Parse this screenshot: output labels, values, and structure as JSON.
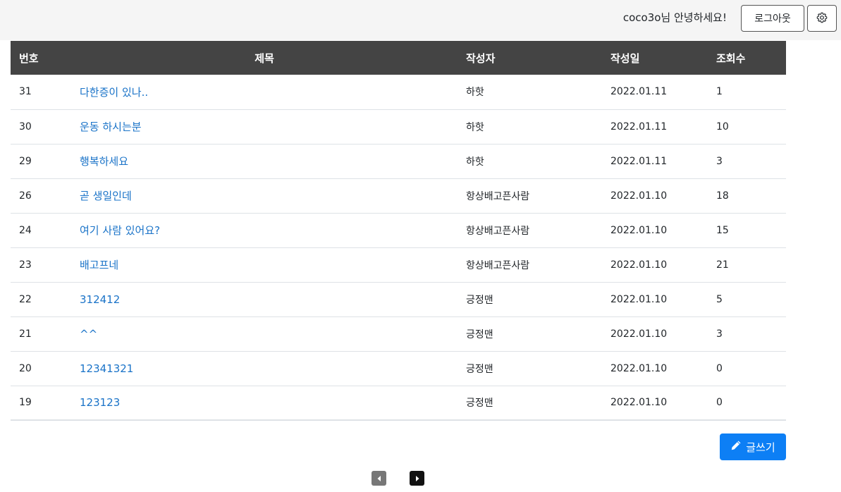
{
  "header": {
    "greeting": "coco3o님 안녕하세요!",
    "logout_label": "로그아웃",
    "settings_icon": "gear-icon"
  },
  "table": {
    "columns": [
      "번호",
      "제목",
      "작성자",
      "작성일",
      "조회수"
    ],
    "rows": [
      {
        "num": "31",
        "title": "다한증이 있나..",
        "author": "하핫",
        "date": "2022.01.11",
        "views": "1"
      },
      {
        "num": "30",
        "title": "운동 하시는분",
        "author": "하핫",
        "date": "2022.01.11",
        "views": "10"
      },
      {
        "num": "29",
        "title": "행복하세요",
        "author": "하핫",
        "date": "2022.01.11",
        "views": "3"
      },
      {
        "num": "26",
        "title": "곧 생일인데",
        "author": "항상배고픈사람",
        "date": "2022.01.10",
        "views": "18"
      },
      {
        "num": "24",
        "title": "여기 사람 있어요?",
        "author": "항상배고픈사람",
        "date": "2022.01.10",
        "views": "15"
      },
      {
        "num": "23",
        "title": "배고프네",
        "author": "항상배고픈사람",
        "date": "2022.01.10",
        "views": "21"
      },
      {
        "num": "22",
        "title": "312412",
        "author": "긍정맨",
        "date": "2022.01.10",
        "views": "5"
      },
      {
        "num": "21",
        "title": "^^",
        "author": "긍정맨",
        "date": "2022.01.10",
        "views": "3"
      },
      {
        "num": "20",
        "title": "12341321",
        "author": "긍정맨",
        "date": "2022.01.10",
        "views": "0"
      },
      {
        "num": "19",
        "title": "123123",
        "author": "긍정맨",
        "date": "2022.01.10",
        "views": "0"
      }
    ]
  },
  "actions": {
    "write_label": "글쓰기",
    "write_icon": "pencil-icon"
  },
  "pagination": {
    "prev_icon": "caret-left-icon",
    "next_icon": "caret-right-icon"
  },
  "colors": {
    "header_bg": "#444444",
    "topbar_bg": "#f5f5f5",
    "link": "#1a73c8",
    "primary": "#0d7ff5"
  }
}
